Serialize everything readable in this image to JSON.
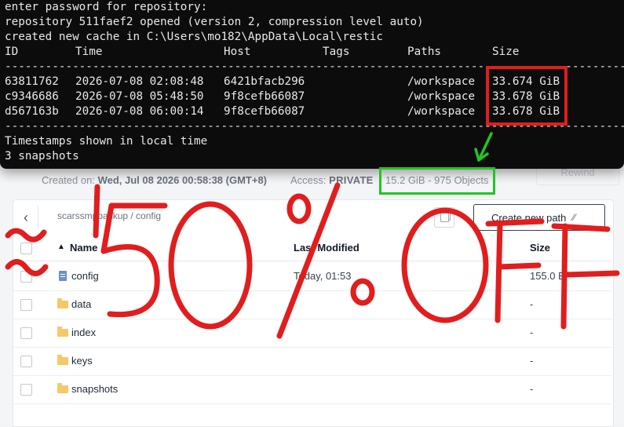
{
  "terminal": {
    "lines": [
      "enter password for repository:",
      "repository 511faef2 opened (version 2, compression level auto)",
      "created new cache in C:\\Users\\mo182\\AppData\\Local\\restic"
    ],
    "header": {
      "id": "ID",
      "time": "Time",
      "host": "Host",
      "tags": "Tags",
      "paths": "Paths",
      "size": "Size"
    },
    "separator": "------------------------------------------------------------------------------------------------",
    "snapshots": [
      {
        "id": "63811762",
        "time": "2026-07-08 02:08:48",
        "host": "6421bfacb296",
        "tags": "",
        "paths": "/workspace",
        "size": "33.674 GiB"
      },
      {
        "id": "c9346686",
        "time": "2026-07-08 05:48:50",
        "host": "9f8cefb66087",
        "tags": "",
        "paths": "/workspace",
        "size": "33.678 GiB"
      },
      {
        "id": "d567163b",
        "time": "2026-07-08 06:00:14",
        "host": "9f8cefb66087",
        "tags": "",
        "paths": "/workspace",
        "size": "33.678 GiB"
      }
    ],
    "footer": [
      "Timestamps shown in local time",
      "3 snapshots"
    ]
  },
  "bucket": {
    "created_label": "Created on:",
    "created_value": "Wed, Jul 08 2026 00:58:38 (GMT+8)",
    "access_label": "Access:",
    "access_value": "PRIVATE",
    "usage": "15.2 GiB - 975 Objects",
    "rewind_label": "Rewind"
  },
  "browser": {
    "breadcrumb": "scarssmpbackup / config",
    "create_path_label": "Create new path",
    "columns": {
      "name": "Name",
      "last_modified": "Last Modified",
      "size": "Size"
    },
    "rows": [
      {
        "name": "config",
        "type": "file",
        "last_modified": "Today, 01:53",
        "size": "155.0 B"
      },
      {
        "name": "data",
        "type": "folder",
        "last_modified": "",
        "size": "-"
      },
      {
        "name": "index",
        "type": "folder",
        "last_modified": "",
        "size": "-"
      },
      {
        "name": "keys",
        "type": "folder",
        "last_modified": "",
        "size": "-"
      },
      {
        "name": "snapshots",
        "type": "folder",
        "last_modified": "",
        "size": "-"
      }
    ]
  },
  "annotation": {
    "handwritten_text": "~50%OFF",
    "red_color": "#e11d1d",
    "green_color": "#22c522"
  }
}
